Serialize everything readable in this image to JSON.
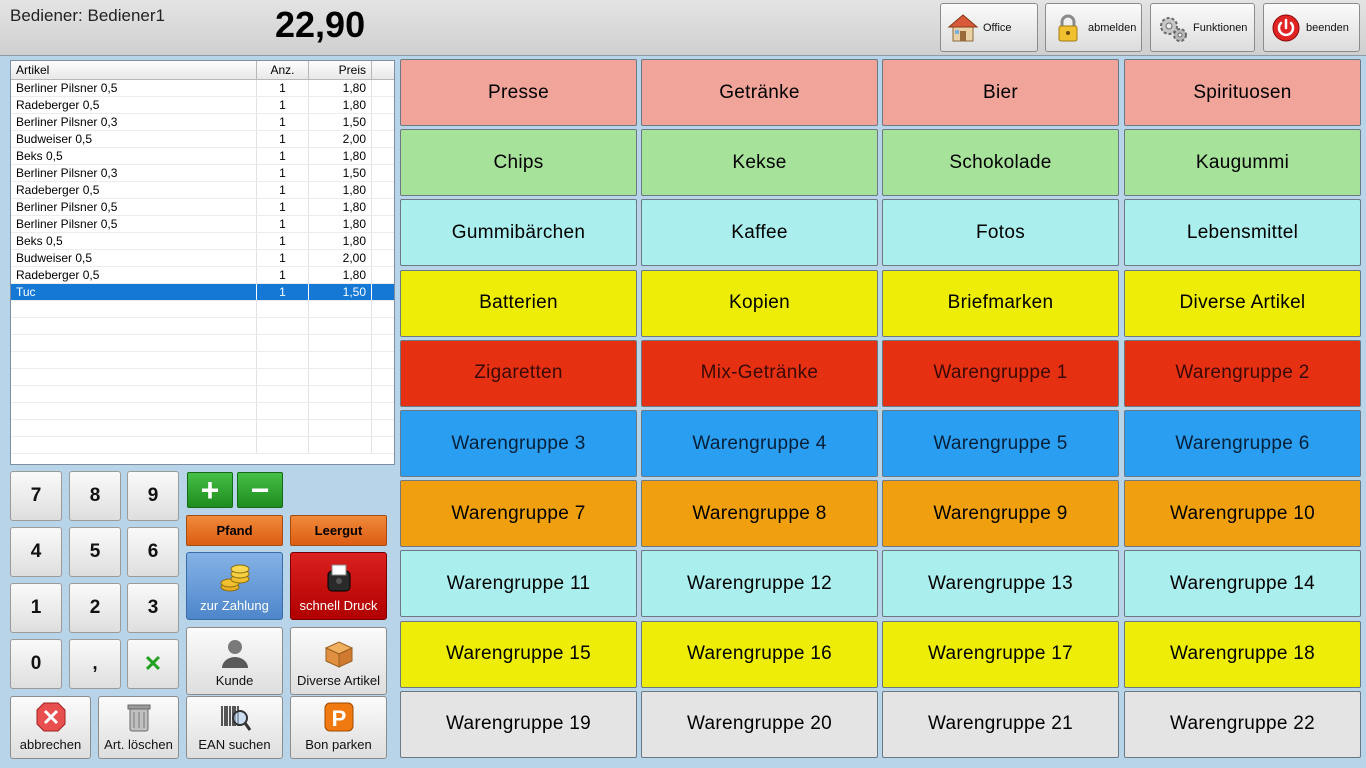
{
  "header": {
    "operator": "Bediener: Bediener1",
    "total": "22,90",
    "buttons": [
      {
        "label": "Office",
        "icon": "house-icon"
      },
      {
        "label": "abmelden",
        "icon": "lock-icon"
      },
      {
        "label": "Funktionen",
        "icon": "gears-icon"
      },
      {
        "label": "beenden",
        "icon": "power-icon"
      }
    ]
  },
  "receipt": {
    "columns": [
      "Artikel",
      "Anz.",
      "Preis"
    ],
    "rows": [
      {
        "name": "Berliner Pilsner 0,5",
        "qty": "1",
        "price": "1,80"
      },
      {
        "name": "Radeberger 0,5",
        "qty": "1",
        "price": "1,80"
      },
      {
        "name": "Berliner Pilsner 0,3",
        "qty": "1",
        "price": "1,50"
      },
      {
        "name": "Budweiser 0,5",
        "qty": "1",
        "price": "2,00"
      },
      {
        "name": "Beks 0,5",
        "qty": "1",
        "price": "1,80"
      },
      {
        "name": "Berliner Pilsner 0,3",
        "qty": "1",
        "price": "1,50"
      },
      {
        "name": "Radeberger 0,5",
        "qty": "1",
        "price": "1,80"
      },
      {
        "name": "Berliner Pilsner 0,5",
        "qty": "1",
        "price": "1,80"
      },
      {
        "name": "Berliner Pilsner 0,5",
        "qty": "1",
        "price": "1,80"
      },
      {
        "name": "Beks 0,5",
        "qty": "1",
        "price": "1,80"
      },
      {
        "name": "Budweiser 0,5",
        "qty": "1",
        "price": "2,00"
      },
      {
        "name": "Radeberger 0,5",
        "qty": "1",
        "price": "1,80"
      },
      {
        "name": "Tuc",
        "qty": "1",
        "price": "1,50"
      }
    ]
  },
  "keypad": {
    "keys": [
      "7",
      "8",
      "9",
      "4",
      "5",
      "6",
      "1",
      "2",
      "3",
      "0",
      ",",
      "✕"
    ]
  },
  "actions": {
    "plus": "+",
    "minus": "−",
    "pfand": "Pfand",
    "leergut": "Leergut",
    "zur_zahlung": "zur Zahlung",
    "schnell_druck": "schnell Druck",
    "kunde": "Kunde",
    "diverse_artikel": "Diverse Artikel",
    "abbrechen": "abbrechen",
    "art_loeschen": "Art. löschen",
    "ean_suchen": "EAN suchen",
    "bon_parken": "Bon parken"
  },
  "categories": [
    {
      "label": "Presse",
      "color": "#f0a49a",
      "text": "#000000"
    },
    {
      "label": "Getränke",
      "color": "#f0a49a",
      "text": "#000000"
    },
    {
      "label": "Bier",
      "color": "#f0a49a",
      "text": "#000000"
    },
    {
      "label": "Spirituosen",
      "color": "#f0a49a",
      "text": "#000000"
    },
    {
      "label": "Chips",
      "color": "#a6e29a",
      "text": "#000000"
    },
    {
      "label": "Kekse",
      "color": "#a6e29a",
      "text": "#000000"
    },
    {
      "label": "Schokolade",
      "color": "#a6e29a",
      "text": "#000000"
    },
    {
      "label": "Kaugummi",
      "color": "#a6e29a",
      "text": "#000000"
    },
    {
      "label": "Gummibärchen",
      "color": "#aaeeee",
      "text": "#000000"
    },
    {
      "label": "Kaffee",
      "color": "#aaeeee",
      "text": "#000000"
    },
    {
      "label": "Fotos",
      "color": "#aaeeee",
      "text": "#000000"
    },
    {
      "label": "Lebensmittel",
      "color": "#aaeeee",
      "text": "#000000"
    },
    {
      "label": "Batterien",
      "color": "#eded08",
      "text": "#000000"
    },
    {
      "label": "Kopien",
      "color": "#eded08",
      "text": "#000000"
    },
    {
      "label": "Briefmarken",
      "color": "#eded08",
      "text": "#000000"
    },
    {
      "label": "Diverse Artikel",
      "color": "#eded08",
      "text": "#000000"
    },
    {
      "label": "Zigaretten",
      "color": "#e63012",
      "text": "#3a0a04"
    },
    {
      "label": "Mix-Getränke",
      "color": "#e63012",
      "text": "#3a0a04"
    },
    {
      "label": "Warengruppe 1",
      "color": "#e63012",
      "text": "#3a0a04"
    },
    {
      "label": "Warengruppe 2",
      "color": "#e63012",
      "text": "#3a0a04"
    },
    {
      "label": "Warengruppe 3",
      "color": "#2a9ef0",
      "text": "#06203a"
    },
    {
      "label": "Warengruppe 4",
      "color": "#2a9ef0",
      "text": "#06203a"
    },
    {
      "label": "Warengruppe 5",
      "color": "#2a9ef0",
      "text": "#06203a"
    },
    {
      "label": "Warengruppe 6",
      "color": "#2a9ef0",
      "text": "#06203a"
    },
    {
      "label": "Warengruppe 7",
      "color": "#f0a00e",
      "text": "#000000"
    },
    {
      "label": "Warengruppe 8",
      "color": "#f0a00e",
      "text": "#000000"
    },
    {
      "label": "Warengruppe 9",
      "color": "#f0a00e",
      "text": "#000000"
    },
    {
      "label": "Warengruppe 10",
      "color": "#f0a00e",
      "text": "#000000"
    },
    {
      "label": "Warengruppe 11",
      "color": "#aaeeee",
      "text": "#000000"
    },
    {
      "label": "Warengruppe 12",
      "color": "#aaeeee",
      "text": "#000000"
    },
    {
      "label": "Warengruppe 13",
      "color": "#aaeeee",
      "text": "#000000"
    },
    {
      "label": "Warengruppe 14",
      "color": "#aaeeee",
      "text": "#000000"
    },
    {
      "label": "Warengruppe 15",
      "color": "#eded08",
      "text": "#000000"
    },
    {
      "label": "Warengruppe 16",
      "color": "#eded08",
      "text": "#000000"
    },
    {
      "label": "Warengruppe 17",
      "color": "#eded08",
      "text": "#000000"
    },
    {
      "label": "Warengruppe 18",
      "color": "#eded08",
      "text": "#000000"
    },
    {
      "label": "Warengruppe 19",
      "color": "#e4e4e4",
      "text": "#000000"
    },
    {
      "label": "Warengruppe 20",
      "color": "#e4e4e4",
      "text": "#000000"
    },
    {
      "label": "Warengruppe 21",
      "color": "#e4e4e4",
      "text": "#000000"
    },
    {
      "label": "Warengruppe 22",
      "color": "#e4e4e4",
      "text": "#000000"
    }
  ]
}
